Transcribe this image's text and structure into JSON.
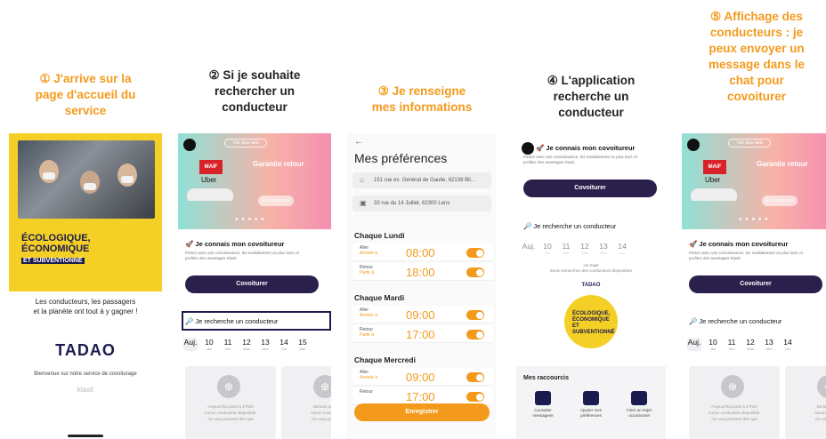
{
  "steps": {
    "s1": "① J'arrive sur la\npage d'accueil du\nservice",
    "s2": "② Si je souhaite\nrechercher un\nconducteur",
    "s3": "③ Je renseigne\nmes informations",
    "s4": "④ L'application\nrecherche un\nconducteur",
    "s5": "⑤ Affichage des\nconducteurs : je\npeux envoyer un\nmessage dans le\nchat pour\ncovoiturer"
  },
  "colors": {
    "accent": "#f39a1c",
    "navy": "#1b1b4e",
    "yellow": "#f4cf25"
  },
  "screen1": {
    "eco_line1": "ÉCOLOGIQUE,",
    "eco_line2": "ÉCONOMIQUE",
    "eco_line3": "ET SUBVENTIONNÉ",
    "tagline": "Les conducteurs, les passagers\net la planète ont tout à y gagner !",
    "brand": "TADAO",
    "welcome": "Bienvenue sur notre service de covoiturage",
    "partner": "klaxit"
  },
  "home": {
    "top_pill": "Voir plus tard",
    "maif": "MAIF",
    "uber": "Uber",
    "guarantee": "Garantie retour",
    "enplus": "En savoir plus",
    "know_driver": "🚀 Je connais mon covoitureur",
    "know_desc": "Partez avec une connaissance, les mediatement ou plus tard, et profitez des avantages Klaxit.",
    "covoiturer": "Covoiturer",
    "search": "🔎 Je recherche un conducteur",
    "days": [
      {
        "d": "Auj.",
        "n": ""
      },
      {
        "d": "Jeu",
        "n": "10"
      },
      {
        "d": "Ven",
        "n": "11"
      },
      {
        "d": "Sam",
        "n": "12"
      },
      {
        "d": "Dim",
        "n": "13"
      },
      {
        "d": "Lun",
        "n": "14"
      },
      {
        "d": "Mar",
        "n": "15"
      }
    ],
    "card_text": "Aujourd'hui partir à 17h00\nAucun conducteur disponible.\nOn vous prévient dès que",
    "card_text2": "Demain partir à\nAucun conducteur\nOn vous prévient"
  },
  "screen3": {
    "back": "←",
    "title": "Mes préférences",
    "addr1": "151 rue ex. Général de Gaulle, 62138 Bil...",
    "addr2": "33 rue du 14 Juillet, 62300 Lens",
    "days": [
      {
        "label": "Chaque Lundi",
        "aller": "08:00",
        "retour": "18:00"
      },
      {
        "label": "Chaque Mardi",
        "aller": "09:00",
        "retour": "17:00"
      },
      {
        "label": "Chaque Mercredi",
        "aller": "09:00",
        "retour": "17:00"
      }
    ],
    "aller": "Aller",
    "arrivee": "Arrivée à",
    "retour": "Retour",
    "partir": "Partir à",
    "save": "Enregistrer"
  },
  "screen4": {
    "searching": "Un trajet\nSeuls recherches des conducteurs disponibles",
    "tadao": "TADAO",
    "eco": "ÉCOLOGIQUE,\nÉCONOMIQUE\nET SUBVENTIONNÉ",
    "shortcuts_title": "Mes raccourcis",
    "sc1": "Consulter\nmessagerie",
    "sc2": "Ajouter mes\npréférences",
    "sc3": "Faire un trajet\noccasionnel"
  }
}
